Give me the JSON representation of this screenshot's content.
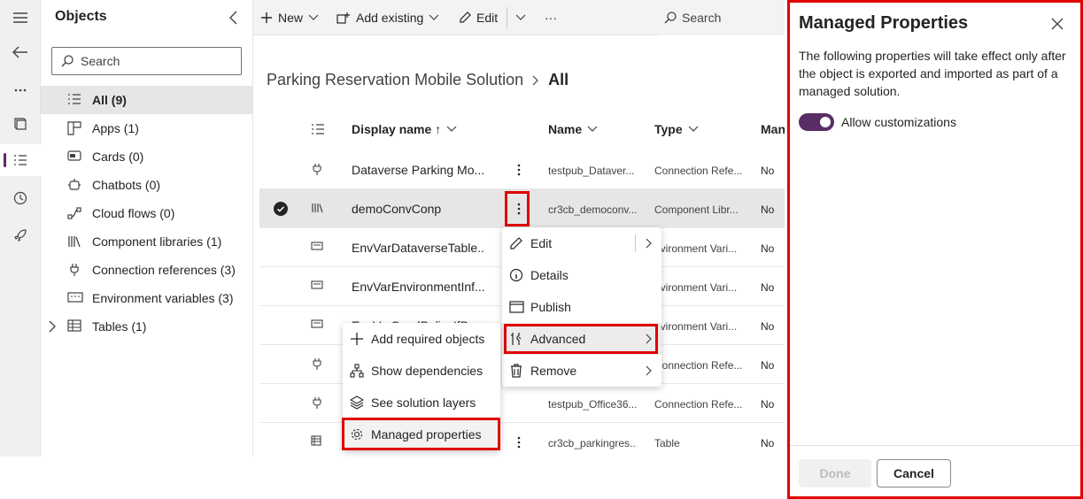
{
  "rail": {
    "icons": [
      "hamburger-icon",
      "back-arrow-icon",
      "more-icon",
      "book-icon",
      "list-icon",
      "history-icon",
      "rocket-icon"
    ]
  },
  "objects": {
    "title": "Objects",
    "search_placeholder": "Search",
    "items": [
      {
        "label": "All  (9)",
        "icon": "list-icon"
      },
      {
        "label": "Apps  (1)",
        "icon": "apps-icon"
      },
      {
        "label": "Cards  (0)",
        "icon": "card-icon"
      },
      {
        "label": "Chatbots  (0)",
        "icon": "bot-icon"
      },
      {
        "label": "Cloud flows  (0)",
        "icon": "flow-icon"
      },
      {
        "label": "Component libraries  (1)",
        "icon": "library-icon"
      },
      {
        "label": "Connection references  (3)",
        "icon": "plug-icon"
      },
      {
        "label": "Environment variables  (3)",
        "icon": "variable-icon"
      },
      {
        "label": "Tables  (1)",
        "icon": "table-icon"
      }
    ]
  },
  "commandbar": {
    "new": "New",
    "add_existing": "Add existing",
    "edit": "Edit",
    "more": "···",
    "search": "Search"
  },
  "breadcrumb": {
    "solution": "Parking Reservation Mobile Solution",
    "current": "All"
  },
  "table": {
    "headers": {
      "display": "Display name ↑",
      "name": "Name",
      "type": "Type",
      "managed": "Man"
    },
    "rows": [
      {
        "display": "Dataverse Parking Mo...",
        "name": "testpub_Dataver...",
        "type": "Connection Refe...",
        "managed": "No",
        "icon": "plug-icon"
      },
      {
        "display": "demoConvConp",
        "name": "cr3cb_democonv...",
        "type": "Component Libr...",
        "managed": "No",
        "icon": "library-icon"
      },
      {
        "display": "EnvVarDataverseTable...",
        "name": "",
        "type": "nvironment Vari...",
        "managed": "No",
        "icon": "variable-icon"
      },
      {
        "display": "EnvVarEnvironmentInf...",
        "name": "",
        "type": "nvironment Vari...",
        "managed": "No",
        "icon": "variable-icon"
      },
      {
        "display": "EnvVarSendPolicyIfB...",
        "name": "",
        "type": "nvironment Vari...",
        "managed": "No",
        "icon": "variable-icon"
      },
      {
        "display": "",
        "name": "",
        "type": "Connection Refe...",
        "managed": "No",
        "icon": "plug-icon"
      },
      {
        "display": "",
        "name": "testpub_Office36...",
        "type": "Connection Refe...",
        "managed": "No",
        "icon": "plug-icon"
      },
      {
        "display": "",
        "name": "cr3cb_parkingres...",
        "type": "Table",
        "managed": "No",
        "icon": "table-icon"
      }
    ]
  },
  "context_menu": {
    "items": [
      {
        "label": "Edit",
        "icon": "pencil-icon"
      },
      {
        "label": "Details",
        "icon": "info-icon"
      },
      {
        "label": "Publish",
        "icon": "publish-icon"
      },
      {
        "label": "Advanced",
        "icon": "tools-icon"
      },
      {
        "label": "Remove",
        "icon": "trash-icon"
      }
    ]
  },
  "advanced_menu": {
    "items": [
      {
        "label": "Add required objects",
        "icon": "plus-icon"
      },
      {
        "label": "Show dependencies",
        "icon": "hierarchy-icon"
      },
      {
        "label": "See solution layers",
        "icon": "layers-icon"
      },
      {
        "label": "Managed properties",
        "icon": "gear-icon"
      }
    ]
  },
  "managed_panel": {
    "title": "Managed Properties",
    "description": "The following properties will take effect only after the object is exported and imported as part of a managed solution.",
    "toggle_label": "Allow customizations",
    "toggle_on": true,
    "done": "Done",
    "cancel": "Cancel"
  },
  "colors": {
    "accent": "#5b2d66",
    "highlight": "#e00000"
  }
}
